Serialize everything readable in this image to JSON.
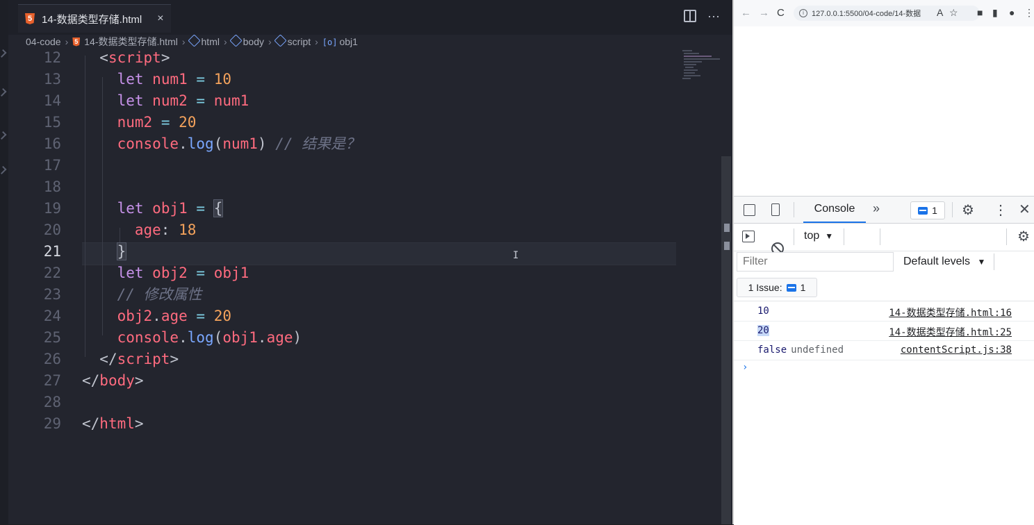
{
  "editor": {
    "tab": {
      "badge": "5",
      "label": "14-数据类型存储.html",
      "close": "×"
    },
    "actions": {
      "more": "⋯"
    },
    "breadcrumb": [
      "04-code",
      "14-数据类型存储.html",
      "html",
      "body",
      "script",
      "obj1"
    ],
    "line_numbers": [
      "12",
      "13",
      "14",
      "15",
      "16",
      "17",
      "18",
      "19",
      "20",
      "21",
      "22",
      "23",
      "24",
      "25",
      "26",
      "27",
      "28",
      "29"
    ],
    "active_line": "21",
    "caret": "I"
  },
  "browser": {
    "nav": {
      "back": "←",
      "forward": "→",
      "reload": "C"
    },
    "address": "127.0.0.1:5500/04-code/14-数据",
    "toolbar_icons": {
      "translate": "A",
      "star": "☆"
    }
  },
  "devtools": {
    "tab_console": "Console",
    "more_tabs": "»",
    "issues_count": "1",
    "context": "top",
    "dropdown": "▼",
    "filter_placeholder": "Filter",
    "levels": "Default levels",
    "issues_label": "1 Issue:",
    "issues_badge": "1",
    "logs": [
      {
        "msg": "10",
        "src": "14-数据类型存储.html:16"
      },
      {
        "msg": "20",
        "src": "14-数据类型存储.html:25"
      },
      {
        "msg": "false",
        "extra": "undefined",
        "src": "contentScript.js:38"
      }
    ],
    "prompt": "›"
  }
}
